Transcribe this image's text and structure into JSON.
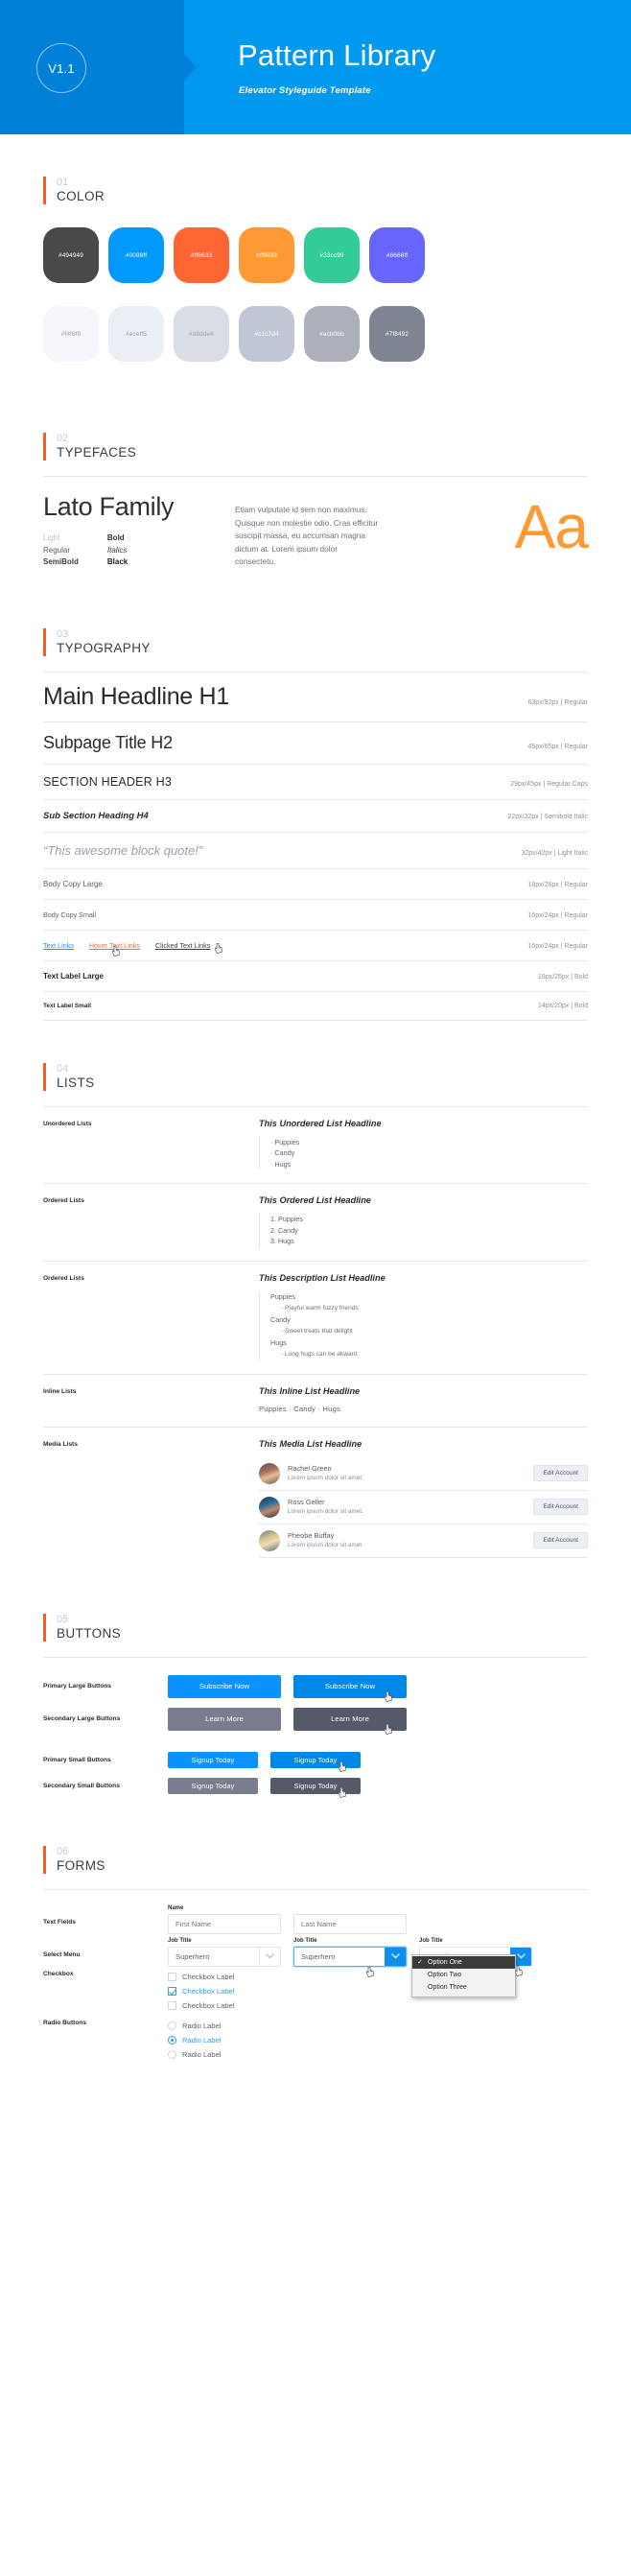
{
  "header": {
    "version": "V1.1",
    "title": "Pattern Library",
    "subtitle": "Elevator  Styleguide Template",
    "bg_color": "#0099f0",
    "bg_color_left": "#0080d6"
  },
  "sections": {
    "color": {
      "num": "01",
      "title": "COLOR"
    },
    "typefaces": {
      "num": "02",
      "title": "TYPEFACES"
    },
    "typography": {
      "num": "03",
      "title": "TYPOGRAPHY"
    },
    "lists": {
      "num": "04",
      "title": "LISTS"
    },
    "buttons": {
      "num": "05",
      "title": "BUTTONS"
    },
    "forms": {
      "num": "06",
      "title": "FORMS"
    }
  },
  "colors": {
    "brand_row": [
      {
        "hex": "#494949",
        "label": "#494949",
        "text": "light"
      },
      {
        "hex": "#0099ff",
        "label": "#0099ff",
        "text": "light"
      },
      {
        "hex": "#ff6633",
        "label": "#ff6633",
        "text": "light"
      },
      {
        "hex": "#ff9933",
        "label": "#ff9933",
        "text": "light"
      },
      {
        "hex": "#33cc99",
        "label": "#33cc99",
        "text": "light"
      },
      {
        "hex": "#6666ff",
        "label": "#6666ff",
        "text": "light"
      }
    ],
    "neutral_row": [
      {
        "hex": "#f4f6f9",
        "label": "#f4f6f9",
        "text": "dark"
      },
      {
        "hex": "#eceff5",
        "label": "#eceff5",
        "text": "dark"
      },
      {
        "hex": "#d8dde6",
        "label": "#d8dde6",
        "text": "dark"
      },
      {
        "hex": "#c1c7d4",
        "label": "#c1c7d4",
        "text": "light"
      },
      {
        "hex": "#acb0bb",
        "label": "#acb0bb",
        "text": "light"
      },
      {
        "hex": "#7f8492",
        "label": "#7f8492",
        "text": "light"
      }
    ]
  },
  "typefaces": {
    "family_name": "Lato Family",
    "weights_left": [
      "Light",
      "Regular",
      "SemiBold"
    ],
    "weights_right": [
      "Bold",
      "Italics",
      "Black"
    ],
    "specimen_text": "Etiam vulputate id sem non maximus. Quisque non molestie odio. Cras efficitur suscipit massa, eu accumsan magna dictum at. Lorem ipsum dolor consectetu.",
    "aa_glyph": "Aa",
    "aa_color": "#ff9933"
  },
  "typography": {
    "rows": [
      {
        "sample": "Main Headline H1",
        "spec": "63px/92px | Regular",
        "style": "t-h1"
      },
      {
        "sample": "Subpage Title H2",
        "spec": "45px/65px | Regular",
        "style": "t-h2"
      },
      {
        "sample": "SECTION HEADER H3",
        "spec": "29px/45px | Regular Caps",
        "style": "t-h3"
      },
      {
        "sample": "Sub Section Heading H4",
        "spec": "22px/32px | Semibold Italic",
        "style": "t-h4"
      },
      {
        "sample": "“This awesome block quote!”",
        "spec": "32px/42px | Light Italic",
        "style": "t-quote"
      },
      {
        "sample": "Body Copy Large",
        "spec": "18px/26px | Regular",
        "style": "t-bodyl"
      },
      {
        "sample": "Body Copy Small",
        "spec": "16px/24px | Regular",
        "style": "t-bodys"
      }
    ],
    "links_row": {
      "spec": "16px/24px | Regular",
      "default": "Text Links",
      "hover": "Hover Text Links",
      "clicked": "Clicked Text Links"
    },
    "label_rows": [
      {
        "sample": "Text Label Large",
        "spec": "18px/26px | Bold",
        "style": "t-labell"
      },
      {
        "sample": "Text Label Small",
        "spec": "14px/20px | Bold",
        "style": "t-labels"
      }
    ]
  },
  "lists": {
    "unordered": {
      "label": "Unordered Lists",
      "headline": "This Unordered List Headline",
      "items": [
        "· Puppies",
        "· Candy",
        "· Hugs"
      ]
    },
    "ordered": {
      "label": "Ordered Lists",
      "headline": "This Ordered List Headline",
      "items": [
        "1. Puppies",
        "2. Candy",
        "3. Hugs"
      ]
    },
    "description": {
      "label": "Ordered Lists",
      "headline": "This Description List Headline",
      "items": [
        {
          "term": "Puppies",
          "def": "- Playful warm fuzzy friends"
        },
        {
          "term": "Candy",
          "def": "- Sweet treats that delight"
        },
        {
          "term": "Hugs",
          "def": "- Long hugs can be akward"
        }
      ]
    },
    "inline": {
      "label": "Inline Lists",
      "headline": "This Inline List Headline",
      "items": "Puppies  ·  Candy  ·  Hugs"
    },
    "media": {
      "label": "Media Lists",
      "headline": "This Media List Headline",
      "items": [
        {
          "name": "Rachel Green",
          "desc": "Lorem ipsum dolor sit amet.",
          "button": "Edit Account"
        },
        {
          "name": "Ross Geller",
          "desc": "Lorem ipsum dolor sit amet.",
          "button": "Edit Account"
        },
        {
          "name": "Pheobe Buffay",
          "desc": "Lorem ipsum dolor sit amet.",
          "button": "Edit Account"
        }
      ]
    }
  },
  "buttons": {
    "rows": [
      {
        "label": "Primary Large Buttons",
        "text": "Subscribe Now",
        "size": "lg",
        "normal_bg": "#0d93ff",
        "hover_bg": "#0088e8"
      },
      {
        "label": "Secondary Large Buttons",
        "text": "Learn More",
        "size": "lg",
        "normal_bg": "#787e8f",
        "hover_bg": "#555a6b"
      },
      {
        "label": "Primary Small Buttons",
        "text": "Signup Today",
        "size": "sm",
        "normal_bg": "#0d93ff",
        "hover_bg": "#0088e8"
      },
      {
        "label": "Secondary Small Buttons",
        "text": "Signup Today",
        "size": "sm",
        "normal_bg": "#787e8f",
        "hover_bg": "#555a6b"
      }
    ]
  },
  "forms": {
    "text_fields": {
      "label": "Text Fields",
      "caption": "Name",
      "first_placeholder": "First Name",
      "last_placeholder": "Last Name"
    },
    "select_menu": {
      "label": "Select Menu",
      "caption": "Job Title",
      "value": "Superhero",
      "options": [
        "Option One",
        "Option Two",
        "Option Three"
      ],
      "selected_option": "Option One"
    },
    "checkbox": {
      "label": "Checkbox",
      "items": [
        {
          "text": "Checkbox Label",
          "checked": false
        },
        {
          "text": "Checkbox Label",
          "checked": true
        },
        {
          "text": "Checkbox Label",
          "checked": false
        }
      ]
    },
    "radio": {
      "label": "Radio Buttons",
      "items": [
        {
          "text": "Radio Label",
          "checked": false
        },
        {
          "text": "Radio Label",
          "checked": true
        },
        {
          "text": "Radio Label",
          "checked": false
        }
      ]
    }
  }
}
